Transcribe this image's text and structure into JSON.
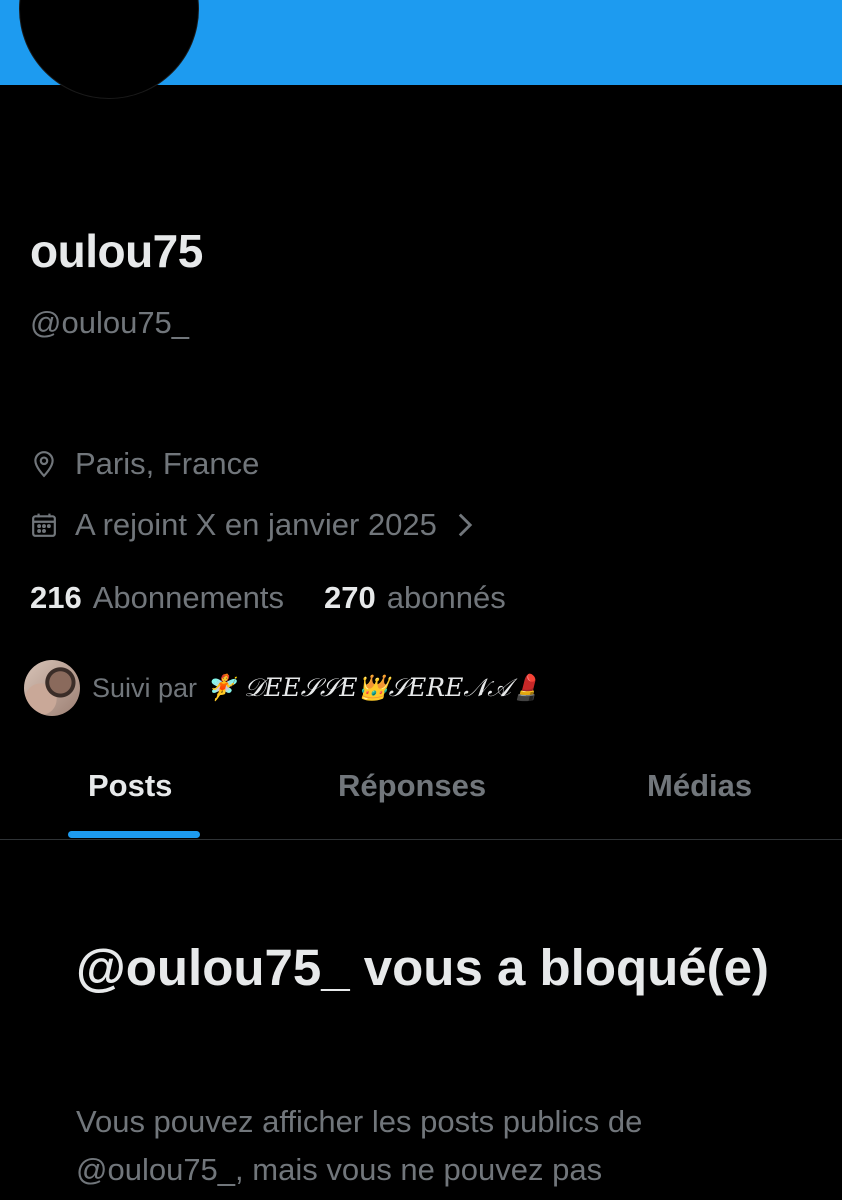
{
  "profile": {
    "display_name": "oulou75",
    "handle": "@oulou75_",
    "location": "Paris, France",
    "joined": "A rejoint X en janvier 2025"
  },
  "stats": {
    "following_count": "216",
    "following_label": "Abonnements",
    "followers_count": "270",
    "followers_label": "abonnés"
  },
  "followed_by": {
    "prefix": "Suivi par",
    "name": "🧚 𝒟𝐸𝐸𝒮𝒮𝐸👑𝒮𝐸𝑅𝐸𝒩𝒜💄"
  },
  "tabs": [
    {
      "label": "Posts",
      "active": true
    },
    {
      "label": "Réponses",
      "active": false
    },
    {
      "label": "Médias",
      "active": false
    }
  ],
  "blocked": {
    "title": "@oulou75_ vous a bloqué(e)",
    "text": "Vous pouvez afficher les posts publics de @oulou75_, mais vous ne pouvez pas"
  },
  "colors": {
    "accent": "#1d9bf0",
    "background": "#000000",
    "text_primary": "#e7e9ea",
    "text_secondary": "#71767b"
  },
  "icons": [
    "location-pin-icon",
    "calendar-icon",
    "chevron-right-icon"
  ]
}
